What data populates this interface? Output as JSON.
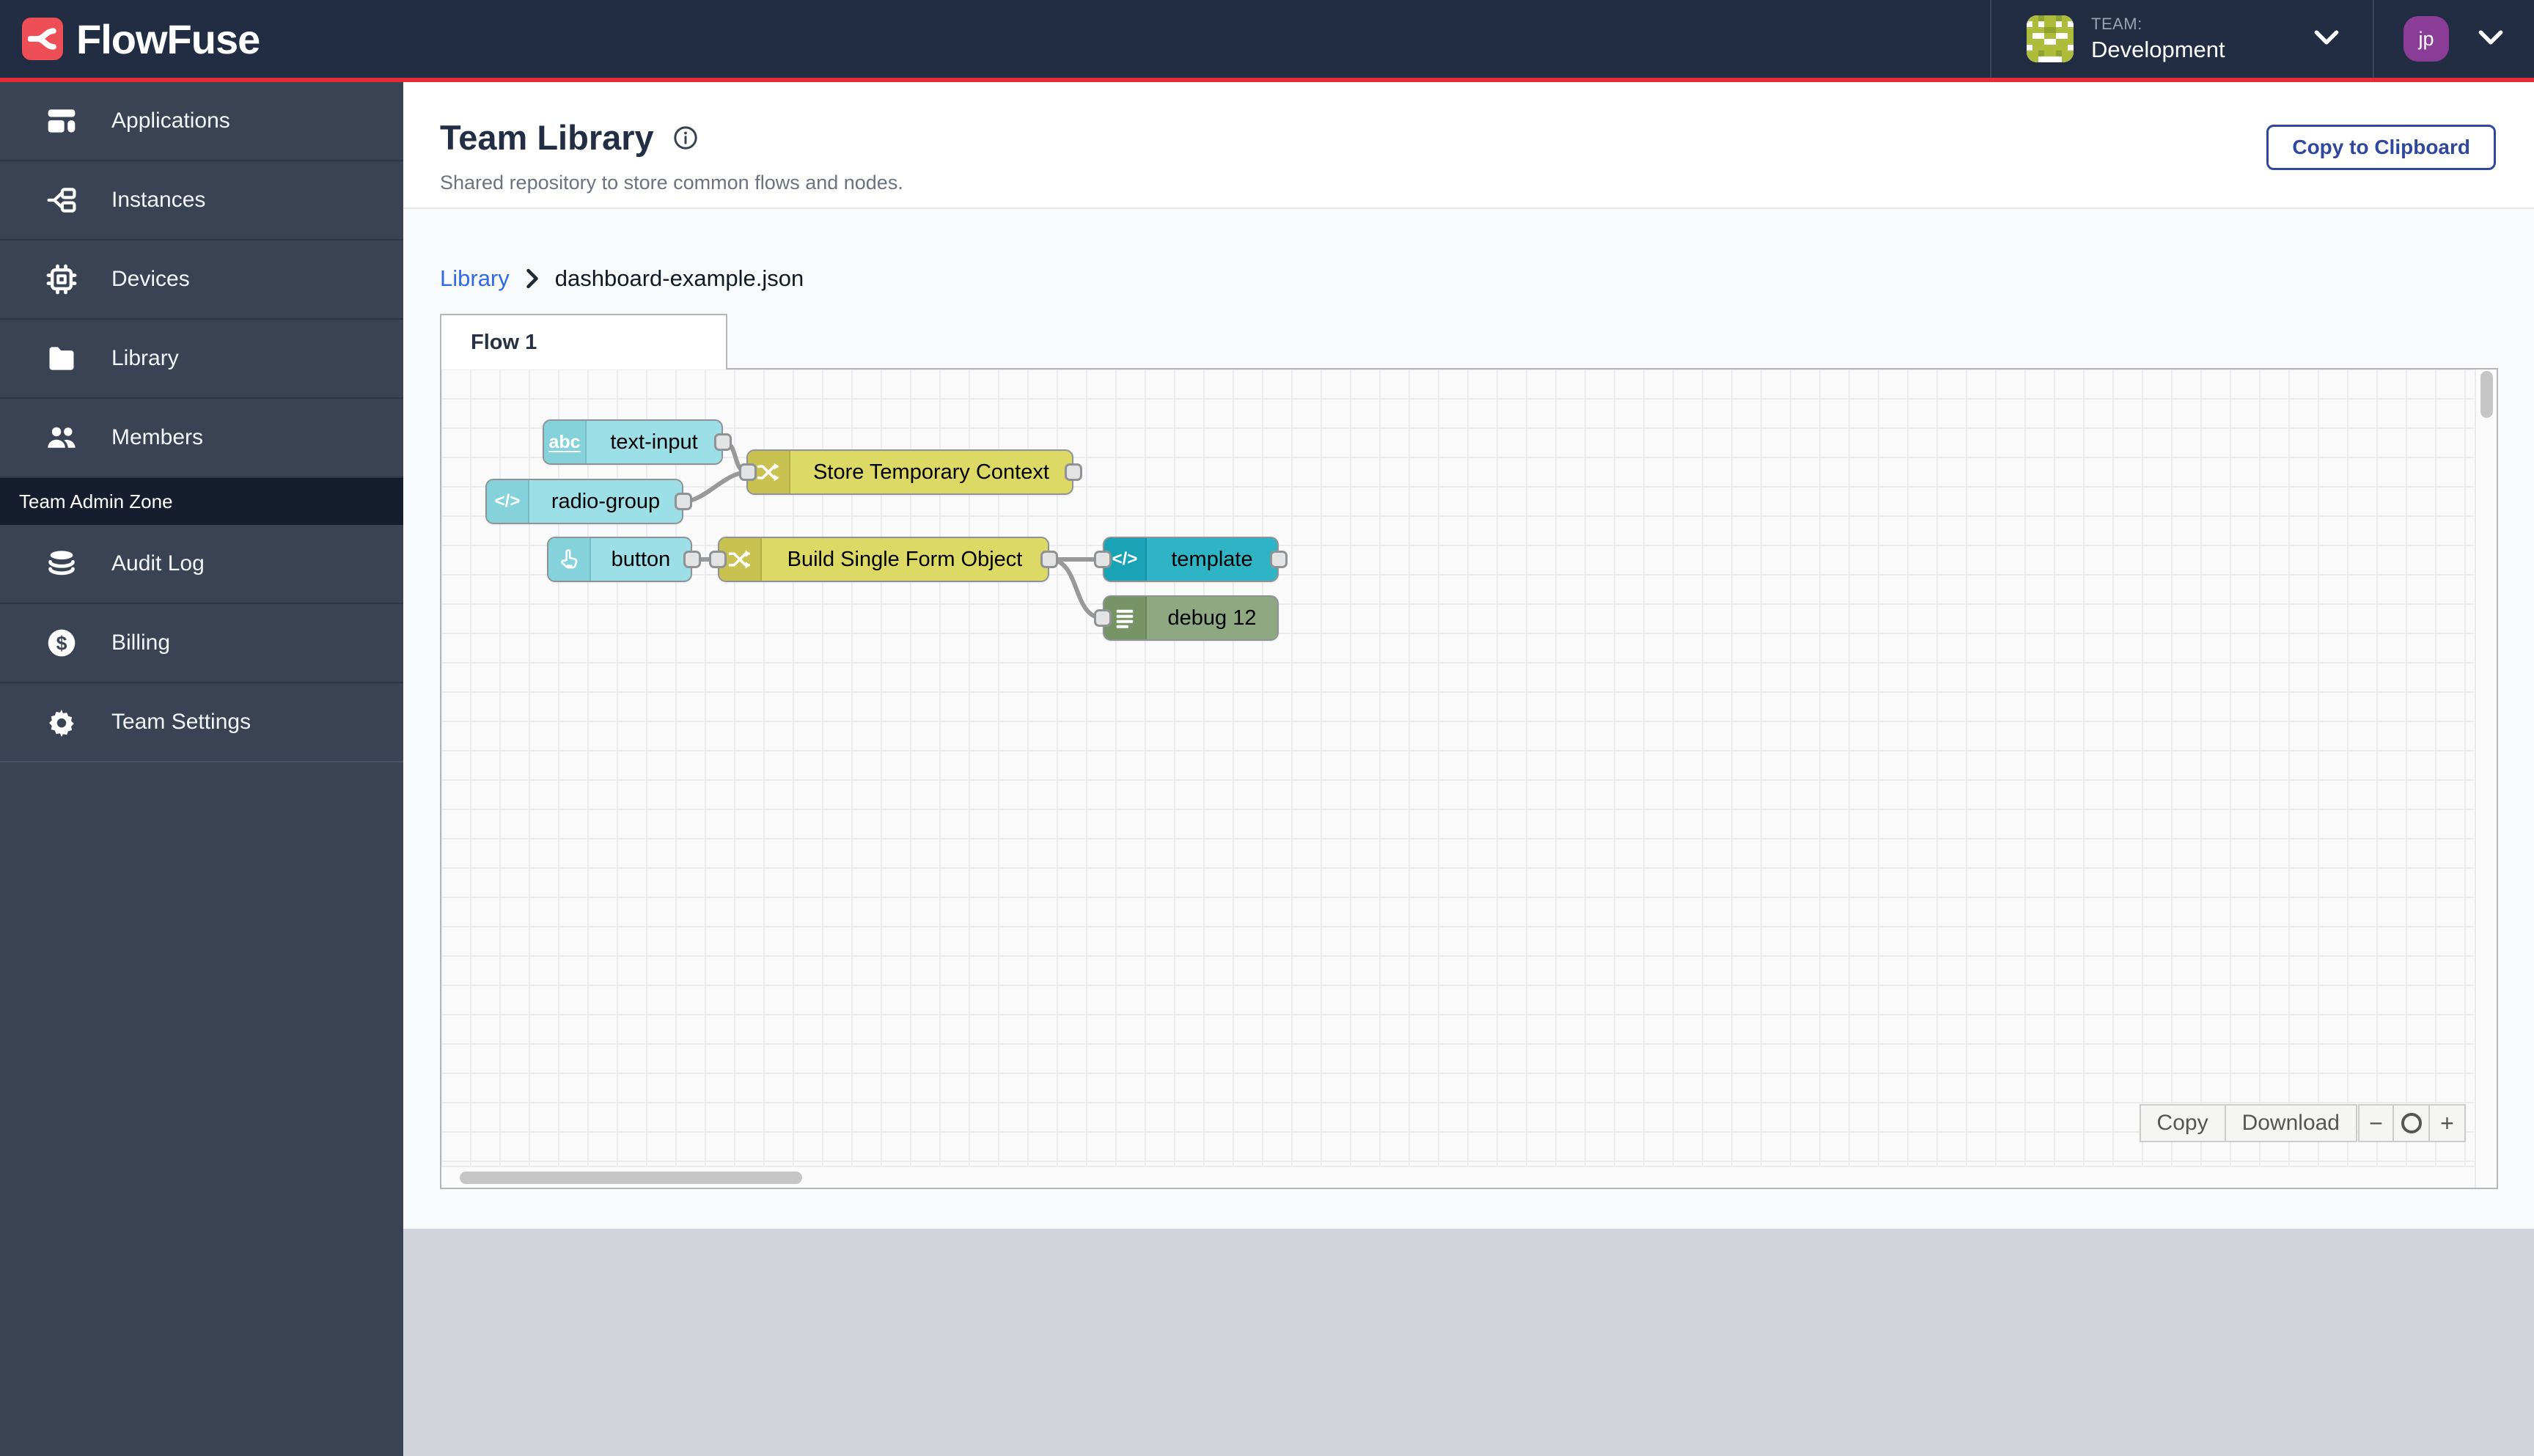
{
  "header": {
    "brand": "FlowFuse",
    "team_label": "TEAM:",
    "team_name": "Development",
    "user_initials": "jp"
  },
  "sidebar": {
    "items": [
      {
        "label": "Applications",
        "icon": "applications-icon"
      },
      {
        "label": "Instances",
        "icon": "instances-icon"
      },
      {
        "label": "Devices",
        "icon": "devices-icon"
      },
      {
        "label": "Library",
        "icon": "library-icon"
      },
      {
        "label": "Members",
        "icon": "members-icon"
      }
    ],
    "admin_section": {
      "label": "Team Admin Zone",
      "items": [
        {
          "label": "Audit Log",
          "icon": "audit-log-icon"
        },
        {
          "label": "Billing",
          "icon": "billing-icon"
        },
        {
          "label": "Team Settings",
          "icon": "settings-icon"
        }
      ]
    }
  },
  "page": {
    "title": "Team Library",
    "subtitle": "Shared repository to store common flows and nodes.",
    "copy_to_clipboard": "Copy to Clipboard"
  },
  "breadcrumb": {
    "library": "Library",
    "current": "dashboard-example.json"
  },
  "flow": {
    "tab_label": "Flow 1",
    "nodes": [
      {
        "label": "text-input",
        "icon": "abc-icon",
        "color": "#9ddfe7",
        "icon_bg": "#85d2db"
      },
      {
        "label": "radio-group",
        "icon": "code-icon",
        "color": "#9ddfe7",
        "icon_bg": "#85d2db"
      },
      {
        "label": "Store Temporary Context",
        "icon": "shuffle-icon",
        "color": "#dcd964",
        "icon_bg": "#c9c250"
      },
      {
        "label": "button",
        "icon": "hand-icon",
        "color": "#9ddfe7",
        "icon_bg": "#85d2db"
      },
      {
        "label": "Build Single Form Object",
        "icon": "shuffle-icon",
        "color": "#dcd964",
        "icon_bg": "#c9c250"
      },
      {
        "label": "template",
        "icon": "code-icon",
        "color": "#2eb4c5",
        "icon_bg": "#1aa2b5"
      },
      {
        "label": "debug 12",
        "icon": "list-icon",
        "color": "#8ea981",
        "icon_bg": "#769465"
      }
    ],
    "node_icon_abc": "abc",
    "node_icon_code": "</>",
    "controls": {
      "copy": "Copy",
      "download": "Download",
      "zoom_out": "−",
      "zoom_in": "+"
    }
  },
  "colors": {
    "header_bg": "#222c43",
    "accent_red": "#e22d36",
    "logo_red": "#ee4f56",
    "sidebar_bg": "#3a4354",
    "admin_band_bg": "#151d2e",
    "button_blue": "#31479e",
    "link_blue": "#2e6be5",
    "wire_gray": "#999999",
    "footer_gray": "#d1d5db",
    "avatar_purple": "#8a3d96",
    "identicon_green": "#aebc3c"
  }
}
